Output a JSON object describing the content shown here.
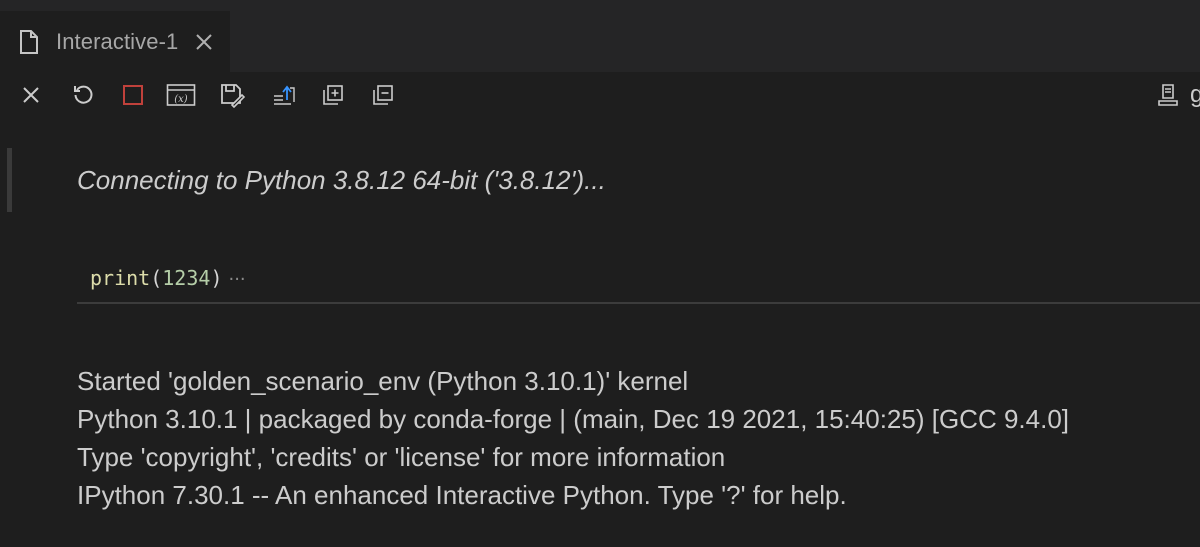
{
  "tab": {
    "label": "Interactive-1",
    "icon": "file-icon",
    "close_icon": "close-icon"
  },
  "toolbar": {
    "buttons": [
      {
        "name": "clear-all-button",
        "icon": "close-icon"
      },
      {
        "name": "restart-kernel-button",
        "icon": "restart-icon"
      },
      {
        "name": "interrupt-kernel-button",
        "icon": "stop-icon"
      },
      {
        "name": "variables-button",
        "icon": "variables-icon",
        "label": "(x)"
      },
      {
        "name": "save-button",
        "icon": "save-icon"
      },
      {
        "name": "export-button",
        "icon": "export-icon"
      },
      {
        "name": "expand-all-button",
        "icon": "expand-icon"
      },
      {
        "name": "collapse-all-button",
        "icon": "collapse-icon"
      }
    ],
    "right_icon": "kernel-icon",
    "right_text": "g"
  },
  "cell": {
    "connecting_message": "Connecting to Python 3.8.12 64-bit ('3.8.12')...",
    "code": {
      "function": "print",
      "open_paren": "(",
      "argument": "1234",
      "close_paren": ")",
      "ellipsis": "···"
    }
  },
  "output": {
    "lines": [
      "Started 'golden_scenario_env (Python 3.10.1)' kernel",
      "Python 3.10.1 | packaged by conda-forge | (main, Dec 19 2021, 15:40:25) [GCC 9.4.0]",
      "Type 'copyright', 'credits' or 'license' for more information",
      "IPython 7.30.1 -- An enhanced Interactive Python. Type '?' for help."
    ]
  },
  "colors": {
    "background": "#1e1e1e",
    "tab_bar": "#252526",
    "stop_icon": "#c0413b"
  }
}
